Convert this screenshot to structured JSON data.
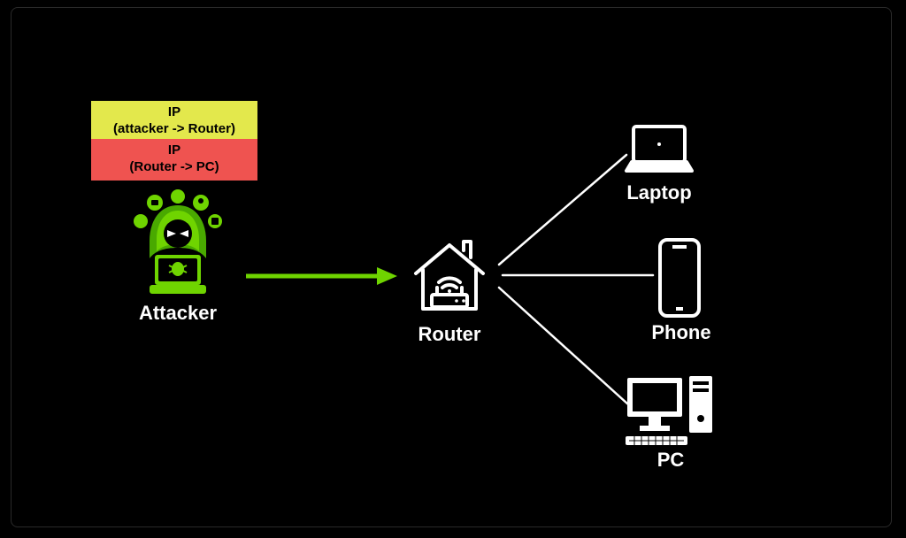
{
  "nodes": {
    "attacker": {
      "label": "Attacker"
    },
    "router": {
      "label": "Router"
    },
    "laptop": {
      "label": "Laptop"
    },
    "phone": {
      "label": "Phone"
    },
    "pc": {
      "label": "PC"
    }
  },
  "packets": {
    "outer": {
      "line1": "IP",
      "line2": "(attacker -> Router)"
    },
    "inner": {
      "line1": "IP",
      "line2": "(Router -> PC)"
    }
  },
  "edges": [
    {
      "from": "attacker",
      "to": "router",
      "type": "arrow-attack"
    },
    {
      "from": "router",
      "to": "laptop",
      "type": "line"
    },
    {
      "from": "router",
      "to": "phone",
      "type": "line"
    },
    {
      "from": "router",
      "to": "pc",
      "type": "line"
    }
  ],
  "colors": {
    "accent_green": "#6fd400",
    "packet_yellow": "#e3e84c",
    "packet_red": "#ef5350",
    "line": "#ffffff"
  }
}
